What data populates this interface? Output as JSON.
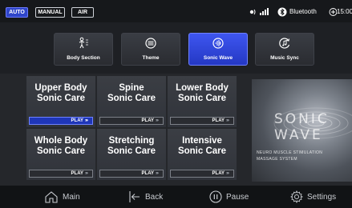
{
  "status": {
    "modes": [
      {
        "label": "AUTO",
        "active": true
      },
      {
        "label": "MANUAL",
        "active": false
      },
      {
        "label": "AIR",
        "active": false
      }
    ],
    "bluetooth_label": "Bluetooth",
    "time": "15:00"
  },
  "tabs": [
    {
      "label": "Body Section",
      "icon": "body-icon",
      "active": false
    },
    {
      "label": "Theme",
      "icon": "theme-icon",
      "active": false
    },
    {
      "label": "Sonic Wave",
      "icon": "sonic-wave-icon",
      "active": true
    },
    {
      "label": "Music Sync",
      "icon": "music-sync-icon",
      "active": false
    }
  ],
  "programs": [
    {
      "line1": "Upper Body",
      "line2": "Sonic Care",
      "play": "PLAY",
      "active": true
    },
    {
      "line1": "Spine",
      "line2": "Sonic Care",
      "play": "PLAY",
      "active": false
    },
    {
      "line1": "Lower Body",
      "line2": "Sonic Care",
      "play": "PLAY",
      "active": false
    },
    {
      "line1": "Whole Body",
      "line2": "Sonic Care",
      "play": "PLAY",
      "active": false
    },
    {
      "line1": "Stretching",
      "line2": "Sonic Care",
      "play": "PLAY",
      "active": false
    },
    {
      "line1": "Intensive",
      "line2": "Sonic Care",
      "play": "PLAY",
      "active": false
    }
  ],
  "promo": {
    "line1": "SONIC",
    "line2": "WAVE",
    "sub1": "NEURO MUSCLE STIMULATION",
    "sub2": "MASSAGE SYSTEM"
  },
  "nav": [
    {
      "label": "Main",
      "icon": "home-icon"
    },
    {
      "label": "Back",
      "icon": "back-icon"
    },
    {
      "label": "Pause",
      "icon": "pause-icon"
    },
    {
      "label": "Settings",
      "icon": "gear-icon"
    }
  ],
  "colors": {
    "accent": "#2f45c9",
    "background": "#1b1d21"
  }
}
